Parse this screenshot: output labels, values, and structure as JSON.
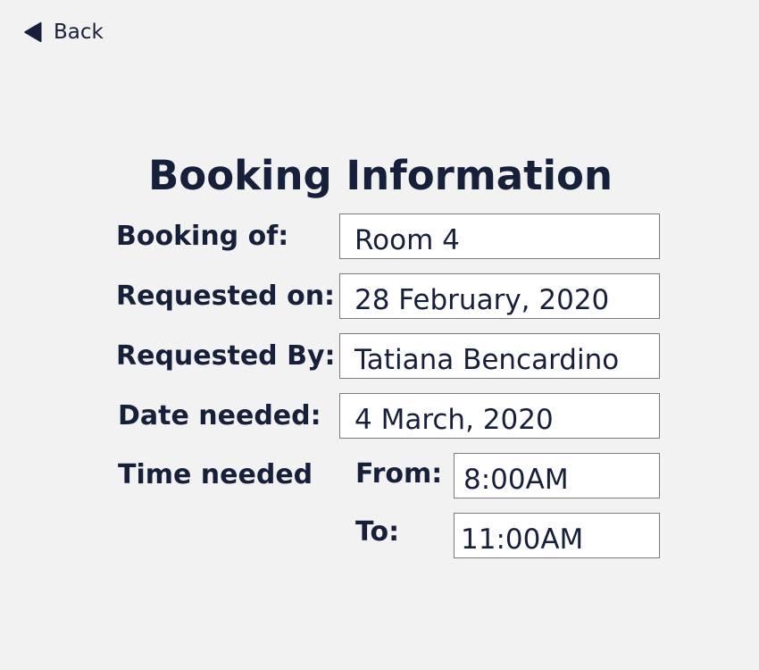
{
  "nav": {
    "back_label": "Back"
  },
  "page": {
    "title": "Booking Information"
  },
  "fields": {
    "booking_of": {
      "label": "Booking of:",
      "value": "Room 4"
    },
    "requested_on": {
      "label": "Requested on:",
      "value": "28 February, 2020"
    },
    "requested_by": {
      "label": "Requested By:",
      "value": "Tatiana Bencardino"
    },
    "date_needed": {
      "label": "Date needed:",
      "value": "4 March, 2020"
    },
    "time_needed": {
      "label": "Time needed",
      "from_label": "From:",
      "from_value": "8:00AM",
      "to_label": "To:",
      "to_value": "11:00AM"
    }
  },
  "colors": {
    "background": "#f2f2f2",
    "text": "#17203a",
    "field_border": "#7b7b7b",
    "field_background": "#ffffff"
  },
  "icons": {
    "back": "triangle-left-icon"
  }
}
